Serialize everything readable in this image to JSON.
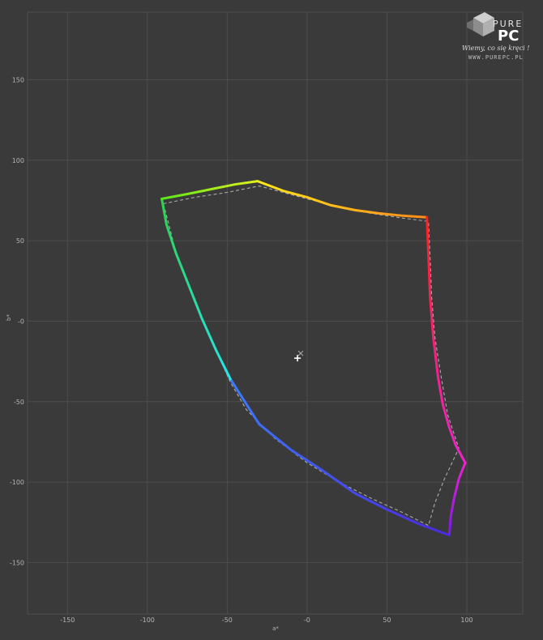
{
  "chart_data": {
    "type": "line",
    "title": "",
    "xlabel": "a*",
    "ylabel": "b*",
    "xlim": [
      -175,
      135
    ],
    "ylim": [
      -182,
      192
    ],
    "xticks": [
      -150,
      -100,
      -50,
      0,
      50,
      100
    ],
    "yticks": [
      -150,
      -100,
      -50,
      0,
      50,
      100,
      150
    ],
    "xtick_labels": [
      "-150",
      "-100",
      "-50",
      "-0",
      "50",
      "100"
    ],
    "ytick_labels": [
      "-150",
      "-100",
      "-50",
      "-0",
      "50",
      "100",
      "150"
    ],
    "grid": true,
    "colors": {
      "background": "#3a3a3a",
      "grid": "#4d4d4d",
      "reference": "#aaaaaa",
      "marker": "#ffffff"
    },
    "series": [
      {
        "style": "measured",
        "segments": [
          {
            "from": "#ffe81a",
            "to": "#ff8a1a",
            "points": [
              [
                -31,
                87
              ],
              [
                -15,
                81
              ],
              [
                0,
                77
              ],
              [
                15,
                72
              ],
              [
                30,
                69
              ],
              [
                45,
                67
              ],
              [
                60,
                65.5
              ],
              [
                75,
                64.5
              ]
            ]
          },
          {
            "from": "#ff2020",
            "to": "#ee22cc",
            "points": [
              [
                75,
                64.5
              ],
              [
                76,
                40
              ],
              [
                77,
                15
              ],
              [
                79,
                -10
              ],
              [
                82,
                -35
              ],
              [
                85,
                -52
              ],
              [
                89,
                -66
              ],
              [
                93,
                -77
              ],
              [
                99,
                -88
              ]
            ]
          },
          {
            "from": "#ee22cc",
            "to": "#7a1aee",
            "points": [
              [
                99,
                -88
              ],
              [
                95,
                -98
              ],
              [
                92,
                -110
              ],
              [
                90,
                -121
              ],
              [
                89,
                -133
              ]
            ]
          },
          {
            "from": "#4a2ae0",
            "to": "#3a7cff",
            "points": [
              [
                89,
                -133
              ],
              [
                70,
                -126
              ],
              [
                50,
                -117
              ],
              [
                30,
                -107
              ],
              [
                10,
                -93
              ],
              [
                -10,
                -80
              ],
              [
                -30,
                -64
              ],
              [
                -48,
                -36
              ]
            ]
          },
          {
            "from": "#28e4e8",
            "to": "#2ad44a",
            "points": [
              [
                -48,
                -36
              ],
              [
                -57,
                -18
              ],
              [
                -66,
                2
              ],
              [
                -74,
                22
              ],
              [
                -82,
                42
              ],
              [
                -88,
                60
              ],
              [
                -91,
                76
              ]
            ]
          },
          {
            "from": "#5de81a",
            "to": "#dff21a",
            "points": [
              [
                -91,
                76
              ],
              [
                -75,
                79
              ],
              [
                -60,
                82
              ],
              [
                -45,
                85
              ],
              [
                -31,
                87
              ]
            ]
          }
        ]
      },
      {
        "style": "reference",
        "points": [
          [
            -90,
            73
          ],
          [
            -70,
            77
          ],
          [
            -50,
            80
          ],
          [
            -30,
            84
          ],
          [
            -15,
            80
          ],
          [
            0,
            76
          ],
          [
            20,
            71
          ],
          [
            40,
            67
          ],
          [
            60,
            64
          ],
          [
            76,
            62
          ],
          [
            77,
            40
          ],
          [
            78,
            15
          ],
          [
            80,
            -10
          ],
          [
            84,
            -35
          ],
          [
            88,
            -58
          ],
          [
            95,
            -79
          ],
          [
            86,
            -98
          ],
          [
            80,
            -113
          ],
          [
            76,
            -127
          ],
          [
            60,
            -119
          ],
          [
            40,
            -110
          ],
          [
            20,
            -100
          ],
          [
            0,
            -88
          ],
          [
            -20,
            -73
          ],
          [
            -38,
            -55
          ],
          [
            -48,
            -38
          ],
          [
            -57,
            -18
          ],
          [
            -66,
            2
          ],
          [
            -74,
            22
          ],
          [
            -82,
            42
          ],
          [
            -86,
            58
          ],
          [
            -90,
            73
          ]
        ]
      }
    ],
    "white_points": [
      {
        "style": "measured",
        "x": -6,
        "y": -23
      },
      {
        "style": "reference",
        "x": -4,
        "y": -20
      }
    ]
  },
  "logo": {
    "line1": "PURE",
    "line2": "PC",
    "tagline": "Wiemy, co się kręci !",
    "url": "WWW.PUREPC.PL"
  }
}
